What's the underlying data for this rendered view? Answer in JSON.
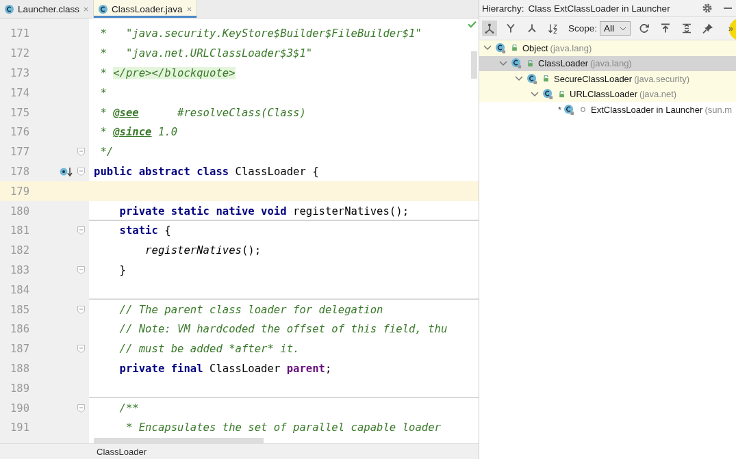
{
  "tabs": [
    {
      "label": "Launcher.class",
      "selected": false
    },
    {
      "label": "ClassLoader.java",
      "selected": true
    }
  ],
  "editor": {
    "lines": [
      {
        "number": "171",
        "tokens": [
          {
            "t": " *   \"java.security.KeyStore$Builder$FileBuilder$1\"",
            "kind": "doc"
          }
        ]
      },
      {
        "number": "172",
        "tokens": [
          {
            "t": " *   \"java.net.URLClassLoader$3$1\"",
            "kind": "doc"
          }
        ]
      },
      {
        "number": "173",
        "tokens": [
          {
            "t": " * ",
            "kind": "doc"
          },
          {
            "t": "</pre></blockquote>",
            "kind": "html"
          }
        ]
      },
      {
        "number": "174",
        "tokens": [
          {
            "t": " *",
            "kind": "doc"
          }
        ]
      },
      {
        "number": "175",
        "tokens": [
          {
            "t": " * ",
            "kind": "doc"
          },
          {
            "t": "@see",
            "kind": "tag"
          },
          {
            "t": "      #resolveClass(Class)",
            "kind": "doc"
          }
        ]
      },
      {
        "number": "176",
        "tokens": [
          {
            "t": " * ",
            "kind": "doc"
          },
          {
            "t": "@since",
            "kind": "tag"
          },
          {
            "t": " 1.0",
            "kind": "doc"
          }
        ]
      },
      {
        "number": "177",
        "fold": true,
        "tokens": [
          {
            "t": " */",
            "kind": "doc"
          }
        ]
      },
      {
        "number": "178",
        "fold": true,
        "marker": true,
        "tokens": [
          {
            "t": "public abstract class ",
            "kind": "kw"
          },
          {
            "t": "ClassLoader {",
            "kind": "plain"
          }
        ]
      },
      {
        "number": "179",
        "current": true
      },
      {
        "number": "180",
        "separator": true,
        "tokens": [
          {
            "t": "    private static native void ",
            "kind": "kw"
          },
          {
            "t": "registerNatives();",
            "kind": "plain"
          }
        ]
      },
      {
        "number": "181",
        "fold": true,
        "tokens": [
          {
            "t": "    static ",
            "kind": "kw"
          },
          {
            "t": "{",
            "kind": "plain"
          }
        ]
      },
      {
        "number": "182",
        "tokens": [
          {
            "t": "        registerNatives",
            "kind": "call"
          },
          {
            "t": "();",
            "kind": "plain"
          }
        ]
      },
      {
        "number": "183",
        "fold": true,
        "tokens": [
          {
            "t": "    }",
            "kind": "plain"
          }
        ]
      },
      {
        "number": "184",
        "separator": true
      },
      {
        "number": "185",
        "fold": true,
        "tokens": [
          {
            "t": "    // The parent class loader for delegation",
            "kind": "comment"
          }
        ]
      },
      {
        "number": "186",
        "tokens": [
          {
            "t": "    // Note: VM hardcoded the offset of this field, thu",
            "kind": "comment"
          }
        ]
      },
      {
        "number": "187",
        "fold": true,
        "tokens": [
          {
            "t": "    // must be added *after* it.",
            "kind": "comment"
          }
        ]
      },
      {
        "number": "188",
        "tokens": [
          {
            "t": "    private final ",
            "kind": "kw"
          },
          {
            "t": "ClassLoader ",
            "kind": "plain"
          },
          {
            "t": "parent",
            "kind": "field"
          },
          {
            "t": ";",
            "kind": "plain"
          }
        ]
      },
      {
        "number": "189",
        "separator": true
      },
      {
        "number": "190",
        "fold": true,
        "tokens": [
          {
            "t": "    /**",
            "kind": "doc"
          }
        ]
      },
      {
        "number": "191",
        "tokens": [
          {
            "t": "     * Encapsulates the set of parallel capable loader",
            "kind": "doc"
          }
        ]
      }
    ]
  },
  "breadcrumb": "ClassLoader",
  "hierarchy": {
    "title_label": "Hierarchy:",
    "title": "Class ExtClassLoader in Launcher",
    "scope_label": "Scope:",
    "scope": "All",
    "more": "»",
    "tree": [
      {
        "name": "Object",
        "package": "(java.lang)",
        "expanded": true,
        "highlighted": true,
        "selected": false,
        "children": [
          {
            "name": "ClassLoader",
            "package": "(java.lang)",
            "expanded": true,
            "selected": true,
            "children": [
              {
                "name": "SecureClassLoader",
                "package": "(java.security)",
                "expanded": true,
                "highlighted": true,
                "selected": false,
                "children": [
                  {
                    "name": "URLClassLoader",
                    "package": "(java.net)",
                    "expanded": true,
                    "highlighted": true,
                    "selected": false,
                    "children": [
                      {
                        "name": "ExtClassLoader in Launcher",
                        "package": "(sun.m",
                        "marker": "*",
                        "highlighted": false,
                        "selected": false
                      }
                    ]
                  }
                ]
              }
            ]
          }
        ]
      }
    ]
  }
}
